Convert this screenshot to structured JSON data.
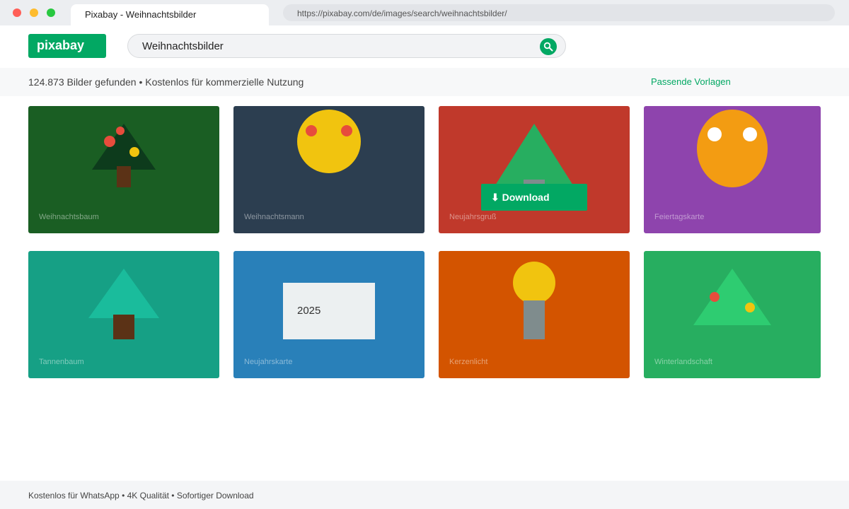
{
  "browser": {
    "tab_title": "Pixabay - Weihnachtsbilder",
    "url": "https://pixabay.com/de/images/search/weihnachtsbilder/"
  },
  "header": {
    "logo": "pixabay",
    "search_value": "Weihnachtsbilder",
    "search_icon": "search-icon"
  },
  "infobar": {
    "results_text": "124.873 Bilder gefunden • Kostenlos für kommerzielle Nutzung",
    "templates_link": "Passende Vorlagen"
  },
  "colors": {
    "brand": "#02a863"
  },
  "cards": [
    {
      "label": "Weihnachtsbaum",
      "bg": "#1a5e23"
    },
    {
      "label": "Weihnachtsmann",
      "bg": "#2c3e50"
    },
    {
      "label": "Neujahrsgruß",
      "bg": "#c0392b",
      "download_label": "⬇ Download"
    },
    {
      "label": "Feiertagskarte",
      "bg": "#8e44ad"
    },
    {
      "label": "Tannenbaum",
      "bg": "#16a085"
    },
    {
      "label": "Neujahrskarte",
      "bg": "#2980b9",
      "text": "2025"
    },
    {
      "label": "Kerzenlicht",
      "bg": "#d35400"
    },
    {
      "label": "Winterlandschaft",
      "bg": "#27ae60"
    }
  ],
  "footer": {
    "text": "Kostenlos für WhatsApp • 4K Qualität • Sofortiger Download"
  }
}
